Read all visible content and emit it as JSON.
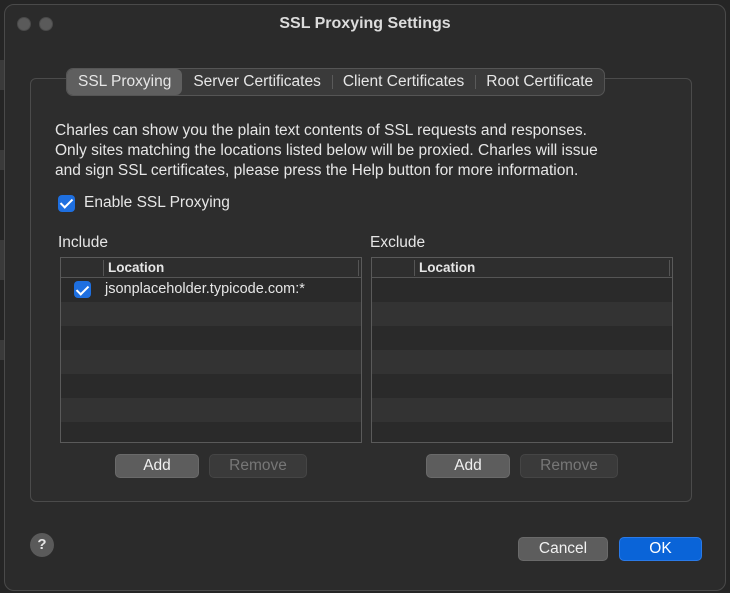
{
  "window": {
    "title": "SSL Proxying Settings"
  },
  "tabs": [
    {
      "label": "SSL Proxying",
      "active": true
    },
    {
      "label": "Server Certificates",
      "active": false
    },
    {
      "label": "Client Certificates",
      "active": false
    },
    {
      "label": "Root Certificate",
      "active": false
    }
  ],
  "description": [
    "Charles can show you the plain text contents of SSL requests and responses.",
    "Only sites matching the locations listed below will be proxied. Charles will issue",
    "and sign SSL certificates, please press the Help button for more information."
  ],
  "enable_ssl": {
    "label": "Enable SSL Proxying",
    "checked": true
  },
  "include": {
    "label": "Include",
    "column": "Location",
    "rows": [
      {
        "location": "jsonplaceholder.typicode.com:*",
        "checked": true
      }
    ],
    "add_label": "Add",
    "remove_label": "Remove"
  },
  "exclude": {
    "label": "Exclude",
    "column": "Location",
    "rows": [],
    "add_label": "Add",
    "remove_label": "Remove"
  },
  "footer": {
    "help_label": "?",
    "cancel_label": "Cancel",
    "ok_label": "OK"
  },
  "colors": {
    "accent": "#0a64d8",
    "checkbox": "#1e6fe0",
    "window_bg": "#2b2b2b"
  }
}
